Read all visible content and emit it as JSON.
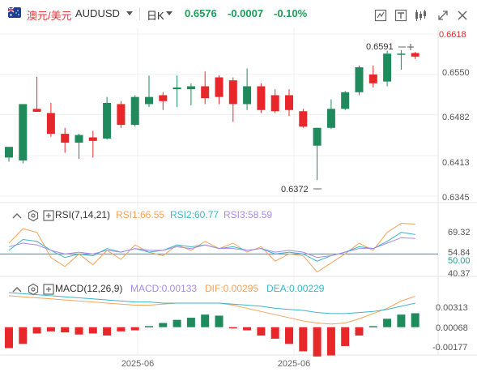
{
  "header": {
    "symbol_zh": "澳元/美元",
    "symbol": "AUDUSD",
    "period": "日K",
    "price": "0.6576",
    "change": "-0.0007",
    "change_pct": "-0.10%",
    "icons": [
      "indicator-icon",
      "text-size-icon",
      "candle-type-icon",
      "fullscreen-icon",
      "close-icon"
    ]
  },
  "colors": {
    "up": "#1f8a5b",
    "down": "#e8272b",
    "rsi1": "#f5a35c",
    "rsi2": "#3db5c9",
    "rsi3": "#a78be8",
    "macd": "#a78be8",
    "dif": "#f5a35c",
    "dea": "#3db5c9",
    "ref_line": "#2a9d8f"
  },
  "price_panel": {
    "axis_labels": [
      "0.6618",
      "0.6550",
      "0.6482",
      "0.6413",
      "0.6345"
    ],
    "high_label": "0.6591",
    "low_label": "0.6372"
  },
  "rsi_panel": {
    "title": "RSI(7,14,21)",
    "rsi1": "RSI1:66.55",
    "rsi2": "RSI2:60.77",
    "rsi3": "RSI3:58.59",
    "axis_labels": [
      "69.32",
      "54.84",
      "50.00",
      "40.37"
    ]
  },
  "macd_panel": {
    "title": "MACD(12,26,9)",
    "macd": "MACD:0.00133",
    "dif": "DIF:0.00295",
    "dea": "DEA:0.00229",
    "axis_labels": [
      "0.00313",
      "0.00068",
      "-0.00177"
    ]
  },
  "x_axis": [
    "2025-06",
    "2025-06"
  ],
  "chart_data": [
    {
      "type": "candlestick",
      "title": "AUDUSD 日K",
      "ylim": [
        0.6345,
        0.6618
      ],
      "yticks": [
        0.6618,
        0.655,
        0.6482,
        0.6413,
        0.6345
      ],
      "annotations": [
        {
          "text": "0.6591",
          "value": 0.6591
        },
        {
          "text": "0.6372",
          "value": 0.6372
        }
      ],
      "candles": [
        {
          "o": 0.641,
          "h": 0.6423,
          "l": 0.6403,
          "c": 0.6428
        },
        {
          "o": 0.6405,
          "h": 0.65,
          "l": 0.64,
          "c": 0.65
        },
        {
          "o": 0.6492,
          "h": 0.6546,
          "l": 0.6488,
          "c": 0.6487
        },
        {
          "o": 0.6485,
          "h": 0.6502,
          "l": 0.6445,
          "c": 0.645
        },
        {
          "o": 0.645,
          "h": 0.646,
          "l": 0.6418,
          "c": 0.6435
        },
        {
          "o": 0.6435,
          "h": 0.645,
          "l": 0.6408,
          "c": 0.6448
        },
        {
          "o": 0.6444,
          "h": 0.6455,
          "l": 0.641,
          "c": 0.6438
        },
        {
          "o": 0.6442,
          "h": 0.6512,
          "l": 0.644,
          "c": 0.6502
        },
        {
          "o": 0.65,
          "h": 0.6505,
          "l": 0.646,
          "c": 0.6465
        },
        {
          "o": 0.6465,
          "h": 0.6515,
          "l": 0.6462,
          "c": 0.6512
        },
        {
          "o": 0.65,
          "h": 0.6548,
          "l": 0.6495,
          "c": 0.6512
        },
        {
          "o": 0.6515,
          "h": 0.652,
          "l": 0.649,
          "c": 0.6505
        },
        {
          "o": 0.6525,
          "h": 0.6548,
          "l": 0.6495,
          "c": 0.6528
        },
        {
          "o": 0.6525,
          "h": 0.6535,
          "l": 0.6498,
          "c": 0.653
        },
        {
          "o": 0.653,
          "h": 0.6555,
          "l": 0.65,
          "c": 0.651
        },
        {
          "o": 0.6545,
          "h": 0.6548,
          "l": 0.65,
          "c": 0.6512
        },
        {
          "o": 0.654,
          "h": 0.6545,
          "l": 0.647,
          "c": 0.65
        },
        {
          "o": 0.65,
          "h": 0.656,
          "l": 0.649,
          "c": 0.653
        },
        {
          "o": 0.653,
          "h": 0.6535,
          "l": 0.6485,
          "c": 0.649
        },
        {
          "o": 0.6515,
          "h": 0.6525,
          "l": 0.6485,
          "c": 0.6488
        },
        {
          "o": 0.6515,
          "h": 0.6525,
          "l": 0.648,
          "c": 0.649
        },
        {
          "o": 0.6488,
          "h": 0.6492,
          "l": 0.646,
          "c": 0.6462
        },
        {
          "o": 0.643,
          "h": 0.646,
          "l": 0.6372,
          "c": 0.646
        },
        {
          "o": 0.646,
          "h": 0.6508,
          "l": 0.6458,
          "c": 0.6492
        },
        {
          "o": 0.6492,
          "h": 0.6522,
          "l": 0.649,
          "c": 0.652
        },
        {
          "o": 0.652,
          "h": 0.6565,
          "l": 0.6515,
          "c": 0.6562
        },
        {
          "o": 0.655,
          "h": 0.6565,
          "l": 0.6528,
          "c": 0.6535
        },
        {
          "o": 0.6538,
          "h": 0.659,
          "l": 0.653,
          "c": 0.6585
        },
        {
          "o": 0.6585,
          "h": 0.6591,
          "l": 0.6558,
          "c": 0.6585
        },
        {
          "o": 0.6586,
          "h": 0.6588,
          "l": 0.6576,
          "c": 0.658
        }
      ]
    },
    {
      "type": "line",
      "title": "RSI(7,14,21)",
      "ylim": [
        38,
        74
      ],
      "yticks": [
        69.32,
        54.84,
        50.0,
        40.37
      ],
      "reference_line": 50,
      "series": [
        {
          "name": "RSI1",
          "values": [
            56,
            64,
            62,
            48,
            43,
            50,
            44,
            52,
            47,
            55,
            51,
            49,
            55,
            52,
            57,
            53,
            56,
            51,
            54,
            46,
            50,
            49,
            40,
            45,
            50,
            56,
            52,
            62,
            67,
            66.55
          ]
        },
        {
          "name": "RSI2",
          "values": [
            52,
            58,
            57,
            52,
            48,
            50,
            49,
            53,
            51,
            53,
            51,
            52,
            55,
            54,
            55,
            53,
            54,
            52,
            53,
            50,
            51,
            50,
            46,
            49,
            51,
            54,
            53,
            57,
            62,
            60.77
          ]
        },
        {
          "name": "RSI3",
          "values": [
            54,
            56,
            55,
            52,
            50,
            51,
            50,
            52,
            51,
            53,
            52,
            52,
            54,
            53,
            55,
            53,
            53,
            52,
            53,
            51,
            52,
            51,
            48,
            49,
            51,
            53,
            53,
            56,
            59,
            58.59
          ]
        }
      ]
    },
    {
      "type": "bar+line",
      "title": "MACD(12,26,9)",
      "ylim": [
        -0.0025,
        0.004
      ],
      "yticks": [
        0.00313,
        0.00068,
        -0.00177
      ],
      "series": [
        {
          "name": "MACD",
          "kind": "bar",
          "values": [
            -0.002,
            -0.0016,
            -0.0006,
            -0.0004,
            -0.0005,
            -0.0007,
            -0.0006,
            -0.0008,
            -0.0004,
            -0.0003,
            0.0001,
            0.0004,
            0.0007,
            0.0009,
            0.0012,
            0.0011,
            -0.0001,
            -0.0003,
            -0.0008,
            -0.0011,
            -0.0016,
            -0.0023,
            -0.0028,
            -0.0027,
            -0.0018,
            -0.0008,
            0.0001,
            0.0008,
            0.0012,
            0.00133
          ]
        },
        {
          "name": "DIF",
          "kind": "line",
          "values": [
            0.003,
            0.0029,
            0.0028,
            0.0027,
            0.0026,
            0.0025,
            0.0024,
            0.0023,
            0.0022,
            0.0021,
            0.0021,
            0.0022,
            0.0023,
            0.0023,
            0.0023,
            0.0023,
            0.0021,
            0.0018,
            0.0015,
            0.0012,
            0.0009,
            0.0006,
            0.0004,
            0.0003,
            0.0004,
            0.0008,
            0.0013,
            0.0018,
            0.0025,
            0.00295
          ]
        },
        {
          "name": "DEA",
          "kind": "line",
          "values": [
            0.0033,
            0.0032,
            0.0031,
            0.003,
            0.0029,
            0.0028,
            0.0027,
            0.0026,
            0.0025,
            0.0024,
            0.0024,
            0.0023,
            0.0023,
            0.0023,
            0.0023,
            0.0023,
            0.0022,
            0.0021,
            0.002,
            0.0018,
            0.0017,
            0.0016,
            0.0014,
            0.0013,
            0.0013,
            0.0014,
            0.0015,
            0.0017,
            0.002,
            0.00229
          ]
        }
      ]
    }
  ]
}
